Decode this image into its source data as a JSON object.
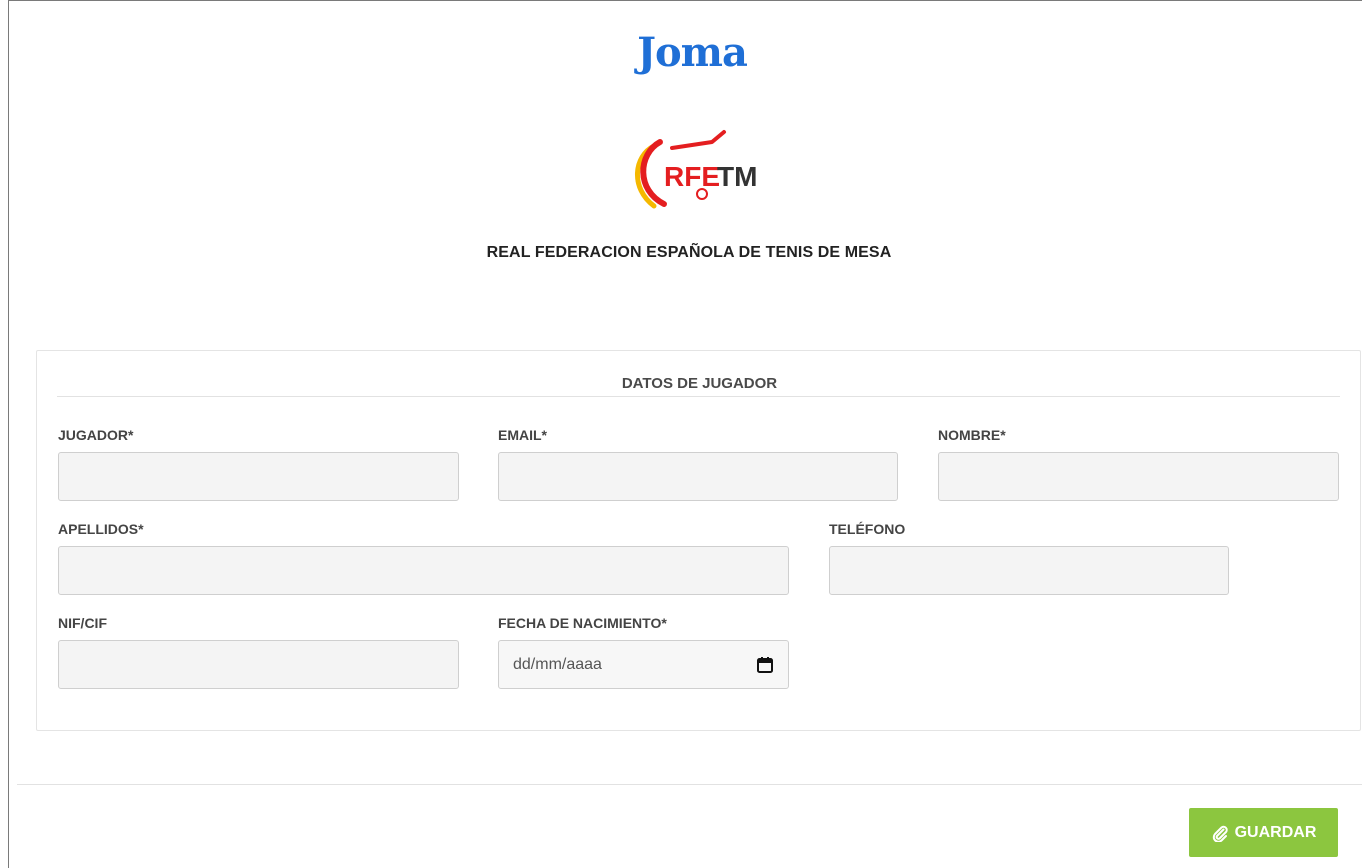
{
  "header": {
    "brand_logo_text": "Joma",
    "federation_logo_text": "RFETM",
    "federation_name": "REAL FEDERACION ESPAÑOLA DE TENIS DE MESA"
  },
  "form": {
    "section_title": "DATOS DE JUGADOR",
    "fields": {
      "jugador": {
        "label": "JUGADOR*",
        "value": ""
      },
      "email": {
        "label": "EMAIL*",
        "value": ""
      },
      "nombre": {
        "label": "NOMBRE*",
        "value": ""
      },
      "apellidos": {
        "label": "APELLIDOS*",
        "value": ""
      },
      "telefono": {
        "label": "TELÉFONO",
        "value": ""
      },
      "nif": {
        "label": "NIF/CIF",
        "value": ""
      },
      "fecha": {
        "label": "FECHA DE NACIMIENTO*",
        "placeholder": "dd/mm/aaaa"
      }
    }
  },
  "actions": {
    "save_label": "GUARDAR",
    "save_color": "#8cc63f"
  },
  "colors": {
    "joma_blue": "#1f6fd6",
    "rfetm_red": "#e41e20",
    "rfetm_yellow": "#f5b800"
  }
}
